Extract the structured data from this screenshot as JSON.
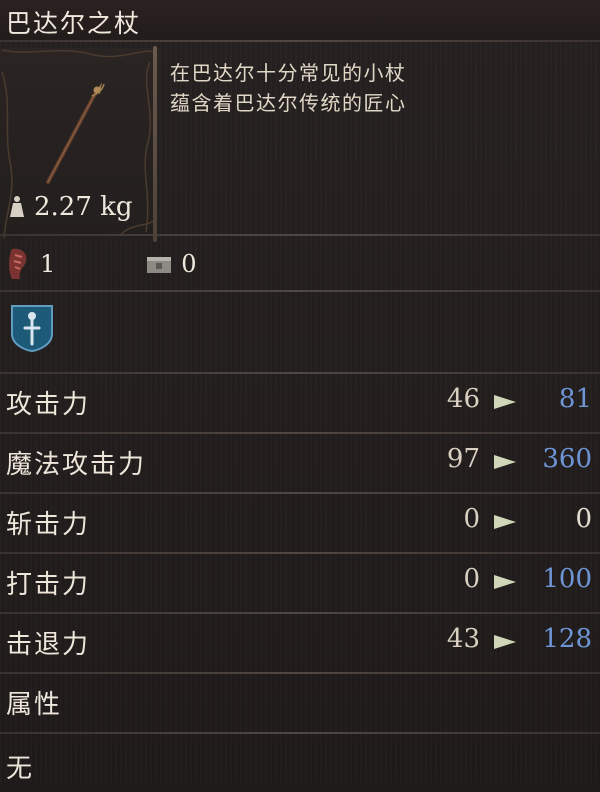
{
  "item": {
    "name": "巴达尔之杖",
    "weight": "2.27 kg",
    "description": [
      "在巴达尔十分常见的小杖",
      "蕴含着巴达尔传统的匠心"
    ]
  },
  "requirements": {
    "strength_value": "1",
    "box_value": "0"
  },
  "stats": [
    {
      "label": "攻击力",
      "base": "46",
      "new": "81",
      "new_color": "#6e95d6"
    },
    {
      "label": "魔法攻击力",
      "base": "97",
      "new": "360",
      "new_color": "#6e95d6"
    },
    {
      "label": "斩击力",
      "base": "0",
      "new": "0",
      "new_color": "#e6ddd0"
    },
    {
      "label": "打击力",
      "base": "0",
      "new": "100",
      "new_color": "#6e95d6"
    },
    {
      "label": "击退力",
      "base": "43",
      "new": "128",
      "new_color": "#6e95d6"
    }
  ],
  "attribute": {
    "label": "属性",
    "value": "无"
  },
  "colors": {
    "background": "#221d1c",
    "accent_blue": "#6e95d6",
    "text": "#e6ddd0"
  },
  "icons": [
    "weight-icon",
    "strength-icon",
    "box-icon",
    "shield-emblem-icon",
    "arrow-right-icon"
  ]
}
